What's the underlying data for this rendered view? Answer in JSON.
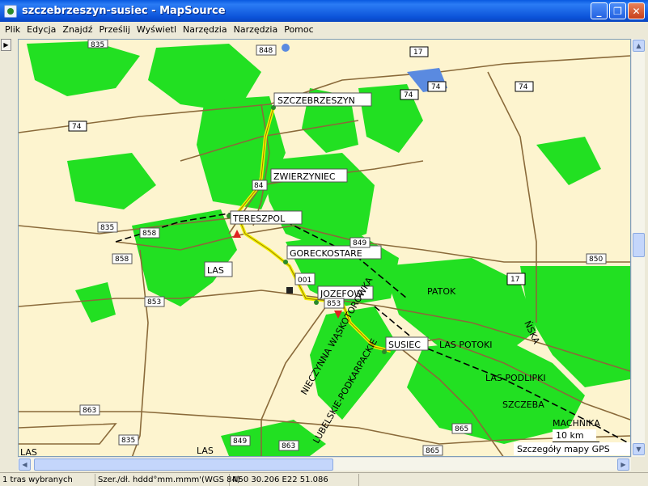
{
  "window": {
    "title": "szczebrzeszyn-susiec - MapSource",
    "minimize_glyph": "_",
    "restore_glyph": "❐",
    "close_glyph": "✕"
  },
  "menu": [
    "Plik",
    "Edycja",
    "Znajdź",
    "Prześlij",
    "Wyświetl",
    "Narzędzia",
    "Narzędzia",
    "Pomoc"
  ],
  "map": {
    "places": {
      "szczebrzeszyn": "SZCZEBRZESZYN",
      "zwierzyniec": "ZWIERZYNIEC",
      "tereszpol": "TERESZPOL",
      "gorecko": "GORECKOSTARE",
      "jozefow": "JOZEFOW",
      "susiec": "SUSIEC",
      "las1": "LAS",
      "las_potoki": "LAS POTOKI",
      "patok": "PATOK",
      "las_podlipki": "LAS PODLIPKI",
      "szczeba": "SZCZEBA",
      "machnika": "MACHNIKA",
      "las2": "LAS",
      "las3": "LAS",
      "waypoint": "001"
    },
    "roads": [
      "835",
      "848",
      "17",
      "74",
      "74",
      "74",
      "74",
      "835",
      "858",
      "858",
      "849",
      "850",
      "17",
      "853",
      "853",
      "863",
      "835",
      "849",
      "863",
      "865",
      "865",
      "84"
    ],
    "diagonal_labels": {
      "wasko": "NIECZYNNA WĄSKOTOROWKA",
      "lubelskie": "LUBELSKIE-PODKARPACKIE",
      "ska": "ŃSKA"
    },
    "scale": "10 km",
    "detail_notice": "Szczegóły mapy GPS"
  },
  "status": {
    "selection": "1 tras wybranych",
    "format": "Szer./dł. hddd°mm.mmm'(WGS 84)",
    "coords": "N50 30.206 E22 51.086"
  },
  "colors": {
    "forest": "#22e022",
    "background": "#fdf4cf",
    "road": "#8a6a3a",
    "route": "#f2f200"
  }
}
